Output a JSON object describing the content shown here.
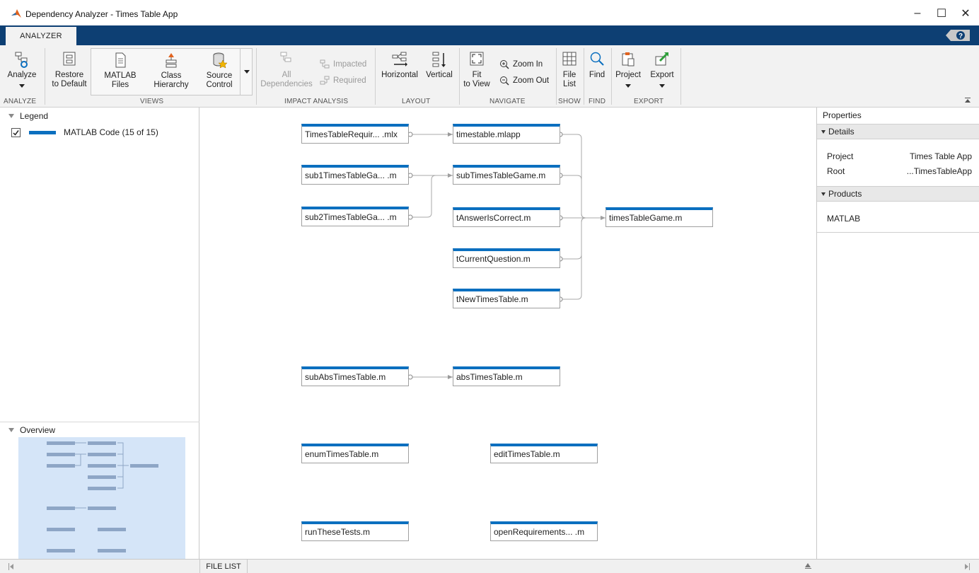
{
  "window": {
    "title": "Dependency Analyzer - Times Table App",
    "controls": {
      "minimize": "–",
      "maximize": "☐",
      "close": "✕"
    }
  },
  "tabs": {
    "active": "ANALYZER",
    "help": "?"
  },
  "ribbon": {
    "analyze": {
      "label": "Analyze",
      "section": "ANALYZE"
    },
    "views": {
      "restore": [
        "Restore",
        "to Default"
      ],
      "matlab_files": [
        "MATLAB",
        "Files"
      ],
      "class_hierarchy": [
        "Class",
        "Hierarchy"
      ],
      "source_control": [
        "Source",
        "Control"
      ],
      "section": "VIEWS"
    },
    "impact": {
      "all_dependencies": [
        "All",
        "Dependencies"
      ],
      "impacted": "Impacted",
      "required": "Required",
      "section": "IMPACT ANALYSIS"
    },
    "layout": {
      "horizontal": "Horizontal",
      "vertical": "Vertical",
      "section": "LAYOUT"
    },
    "navigate": {
      "fit": [
        "Fit",
        "to View"
      ],
      "zoom_in": "Zoom In",
      "zoom_out": "Zoom Out",
      "section": "NAVIGATE"
    },
    "show": {
      "file_list": [
        "File",
        "List"
      ],
      "section": "SHOW"
    },
    "find": {
      "label": "Find",
      "section": "FIND"
    },
    "export": {
      "project": "Project",
      "export": "Export",
      "section": "EXPORT"
    }
  },
  "legend": {
    "header": "Legend",
    "item": "MATLAB Code (15 of 15)",
    "checked": true,
    "color": "#0b6fbf"
  },
  "overview": {
    "header": "Overview"
  },
  "graph": {
    "nodes": [
      {
        "id": "n1",
        "label": "TimesTableRequir... .mlx"
      },
      {
        "id": "n2",
        "label": "sub1TimesTableGa... .m"
      },
      {
        "id": "n3",
        "label": "sub2TimesTableGa... .m"
      },
      {
        "id": "n4",
        "label": "timestable.mlapp"
      },
      {
        "id": "n5",
        "label": "subTimesTableGame.m"
      },
      {
        "id": "n6",
        "label": "tAnswerIsCorrect.m"
      },
      {
        "id": "n7",
        "label": "tCurrentQuestion.m"
      },
      {
        "id": "n8",
        "label": "tNewTimesTable.m"
      },
      {
        "id": "n9",
        "label": "timesTableGame.m"
      },
      {
        "id": "n10",
        "label": "subAbsTimesTable.m"
      },
      {
        "id": "n11",
        "label": "absTimesTable.m"
      },
      {
        "id": "n12",
        "label": "enumTimesTable.m"
      },
      {
        "id": "n13",
        "label": "editTimesTable.m"
      },
      {
        "id": "n14",
        "label": "runTheseTests.m"
      },
      {
        "id": "n15",
        "label": "openRequirements... .m"
      }
    ],
    "edges": [
      [
        "n1",
        "n4"
      ],
      [
        "n2",
        "n5"
      ],
      [
        "n3",
        "n5"
      ],
      [
        "n4",
        "n9"
      ],
      [
        "n5",
        "n9"
      ],
      [
        "n6",
        "n9"
      ],
      [
        "n7",
        "n9"
      ],
      [
        "n8",
        "n9"
      ],
      [
        "n10",
        "n11"
      ]
    ]
  },
  "properties": {
    "title": "Properties",
    "details_header": "Details",
    "project_label": "Project",
    "project_value": "Times Table App",
    "root_label": "Root",
    "root_value": "...TimesTableApp",
    "products_header": "Products",
    "product": "MATLAB"
  },
  "statusbar": {
    "file_list_tab": "FILE LIST"
  },
  "colors": {
    "accent": "#0b6fbf",
    "tabstrip": "#0d3f73",
    "ribbon": "#f2f2f2"
  }
}
